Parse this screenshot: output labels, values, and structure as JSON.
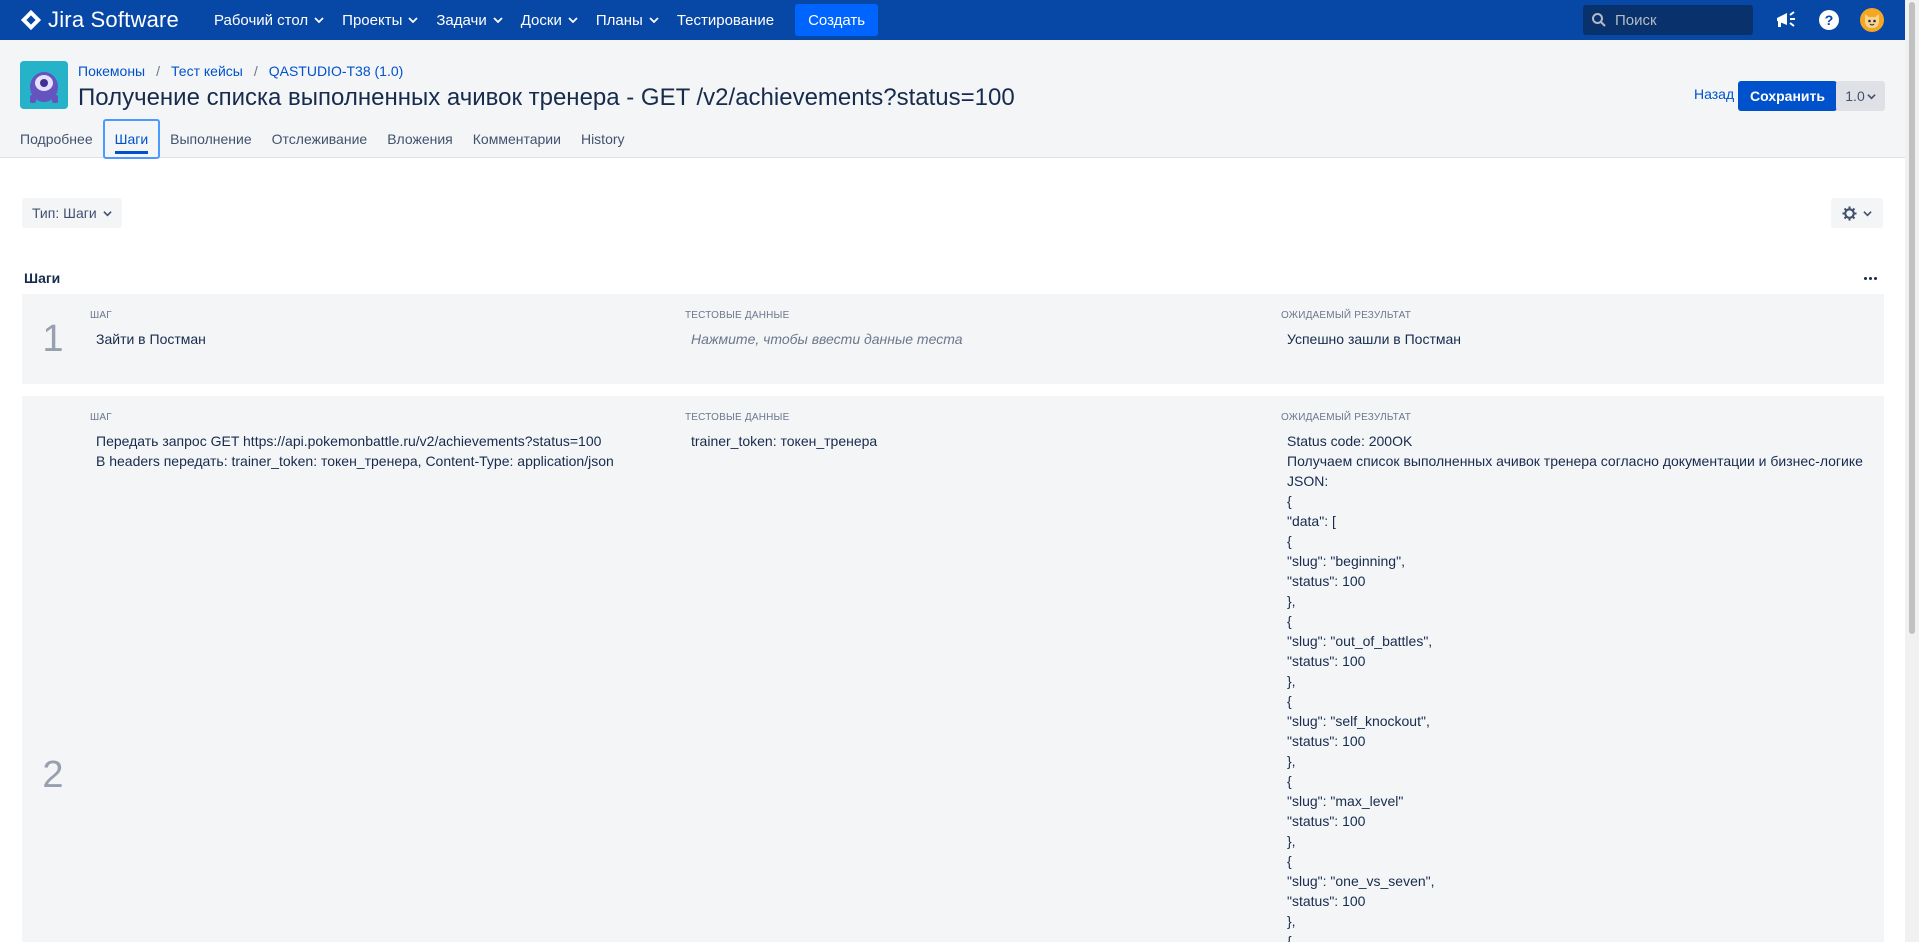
{
  "topnav": {
    "brand": "Jira Software",
    "items": [
      {
        "label": "Рабочий стол",
        "dropdown": true
      },
      {
        "label": "Проекты",
        "dropdown": true
      },
      {
        "label": "Задачи",
        "dropdown": true
      },
      {
        "label": "Доски",
        "dropdown": true
      },
      {
        "label": "Планы",
        "dropdown": true
      },
      {
        "label": "Тестирование",
        "dropdown": false
      }
    ],
    "create_label": "Создать",
    "search_placeholder": "Поиск",
    "icons": [
      "megaphone-icon",
      "help-icon",
      "user-avatar"
    ],
    "bg_color": "#0747a6"
  },
  "header": {
    "breadcrumbs": [
      "Покемоны",
      "Тест кейсы",
      "QASTUDIO-T38 (1.0)"
    ],
    "title": "Получение списка выполненных ачивок тренера - GET /v2/achievements?status=100",
    "back_label": "Назад",
    "save_label": "Сохранить",
    "version_label": "1.0"
  },
  "tabs": [
    {
      "label": "Подробнее",
      "active": false
    },
    {
      "label": "Шаги",
      "active": true
    },
    {
      "label": "Выполнение",
      "active": false
    },
    {
      "label": "Отслеживание",
      "active": false
    },
    {
      "label": "Вложения",
      "active": false
    },
    {
      "label": "Комментарии",
      "active": false
    },
    {
      "label": "History",
      "active": false
    }
  ],
  "controls": {
    "type_label": "Тип: Шаги"
  },
  "steps_section": {
    "title": "Шаги",
    "col_step": "ШАГ",
    "col_data": "ТЕСТОВЫЕ ДАННЫЕ",
    "col_result": "ОЖИДАЕМЫЙ РЕЗУЛЬТАТ",
    "steps": [
      {
        "number": "1",
        "step": [
          "Зайти в Постман"
        ],
        "data": [],
        "data_placeholder": "Нажмите, чтобы ввести данные теста",
        "result": [
          "Успешно зашли в Постман"
        ]
      },
      {
        "number": "2",
        "step": [
          "Передать запрос GET https://api.pokemonbattle.ru/v2/achievements?status=100",
          "В headers передать: trainer_token: токен_тренера, Content-Type: application/json"
        ],
        "data": [
          "trainer_token: токен_тренера"
        ],
        "data_placeholder": "",
        "result": [
          "Status code: 200OK",
          "Получаем список выполненных ачивок тренера согласно документации и бизнес-логике",
          "JSON:",
          "{",
          "\"data\": [",
          "{",
          "\"slug\": \"beginning\",",
          "\"status\": 100",
          "},",
          "{",
          "\"slug\": \"out_of_battles\",",
          "\"status\": 100",
          "},",
          "{",
          "\"slug\": \"self_knockout\",",
          "\"status\": 100",
          "},",
          "{",
          "\"slug\": \"max_level\"",
          "\"status\": 100",
          "},",
          "{",
          "\"slug\": \"one_vs_seven\",",
          "\"status\": 100",
          "},",
          "{"
        ]
      }
    ]
  }
}
